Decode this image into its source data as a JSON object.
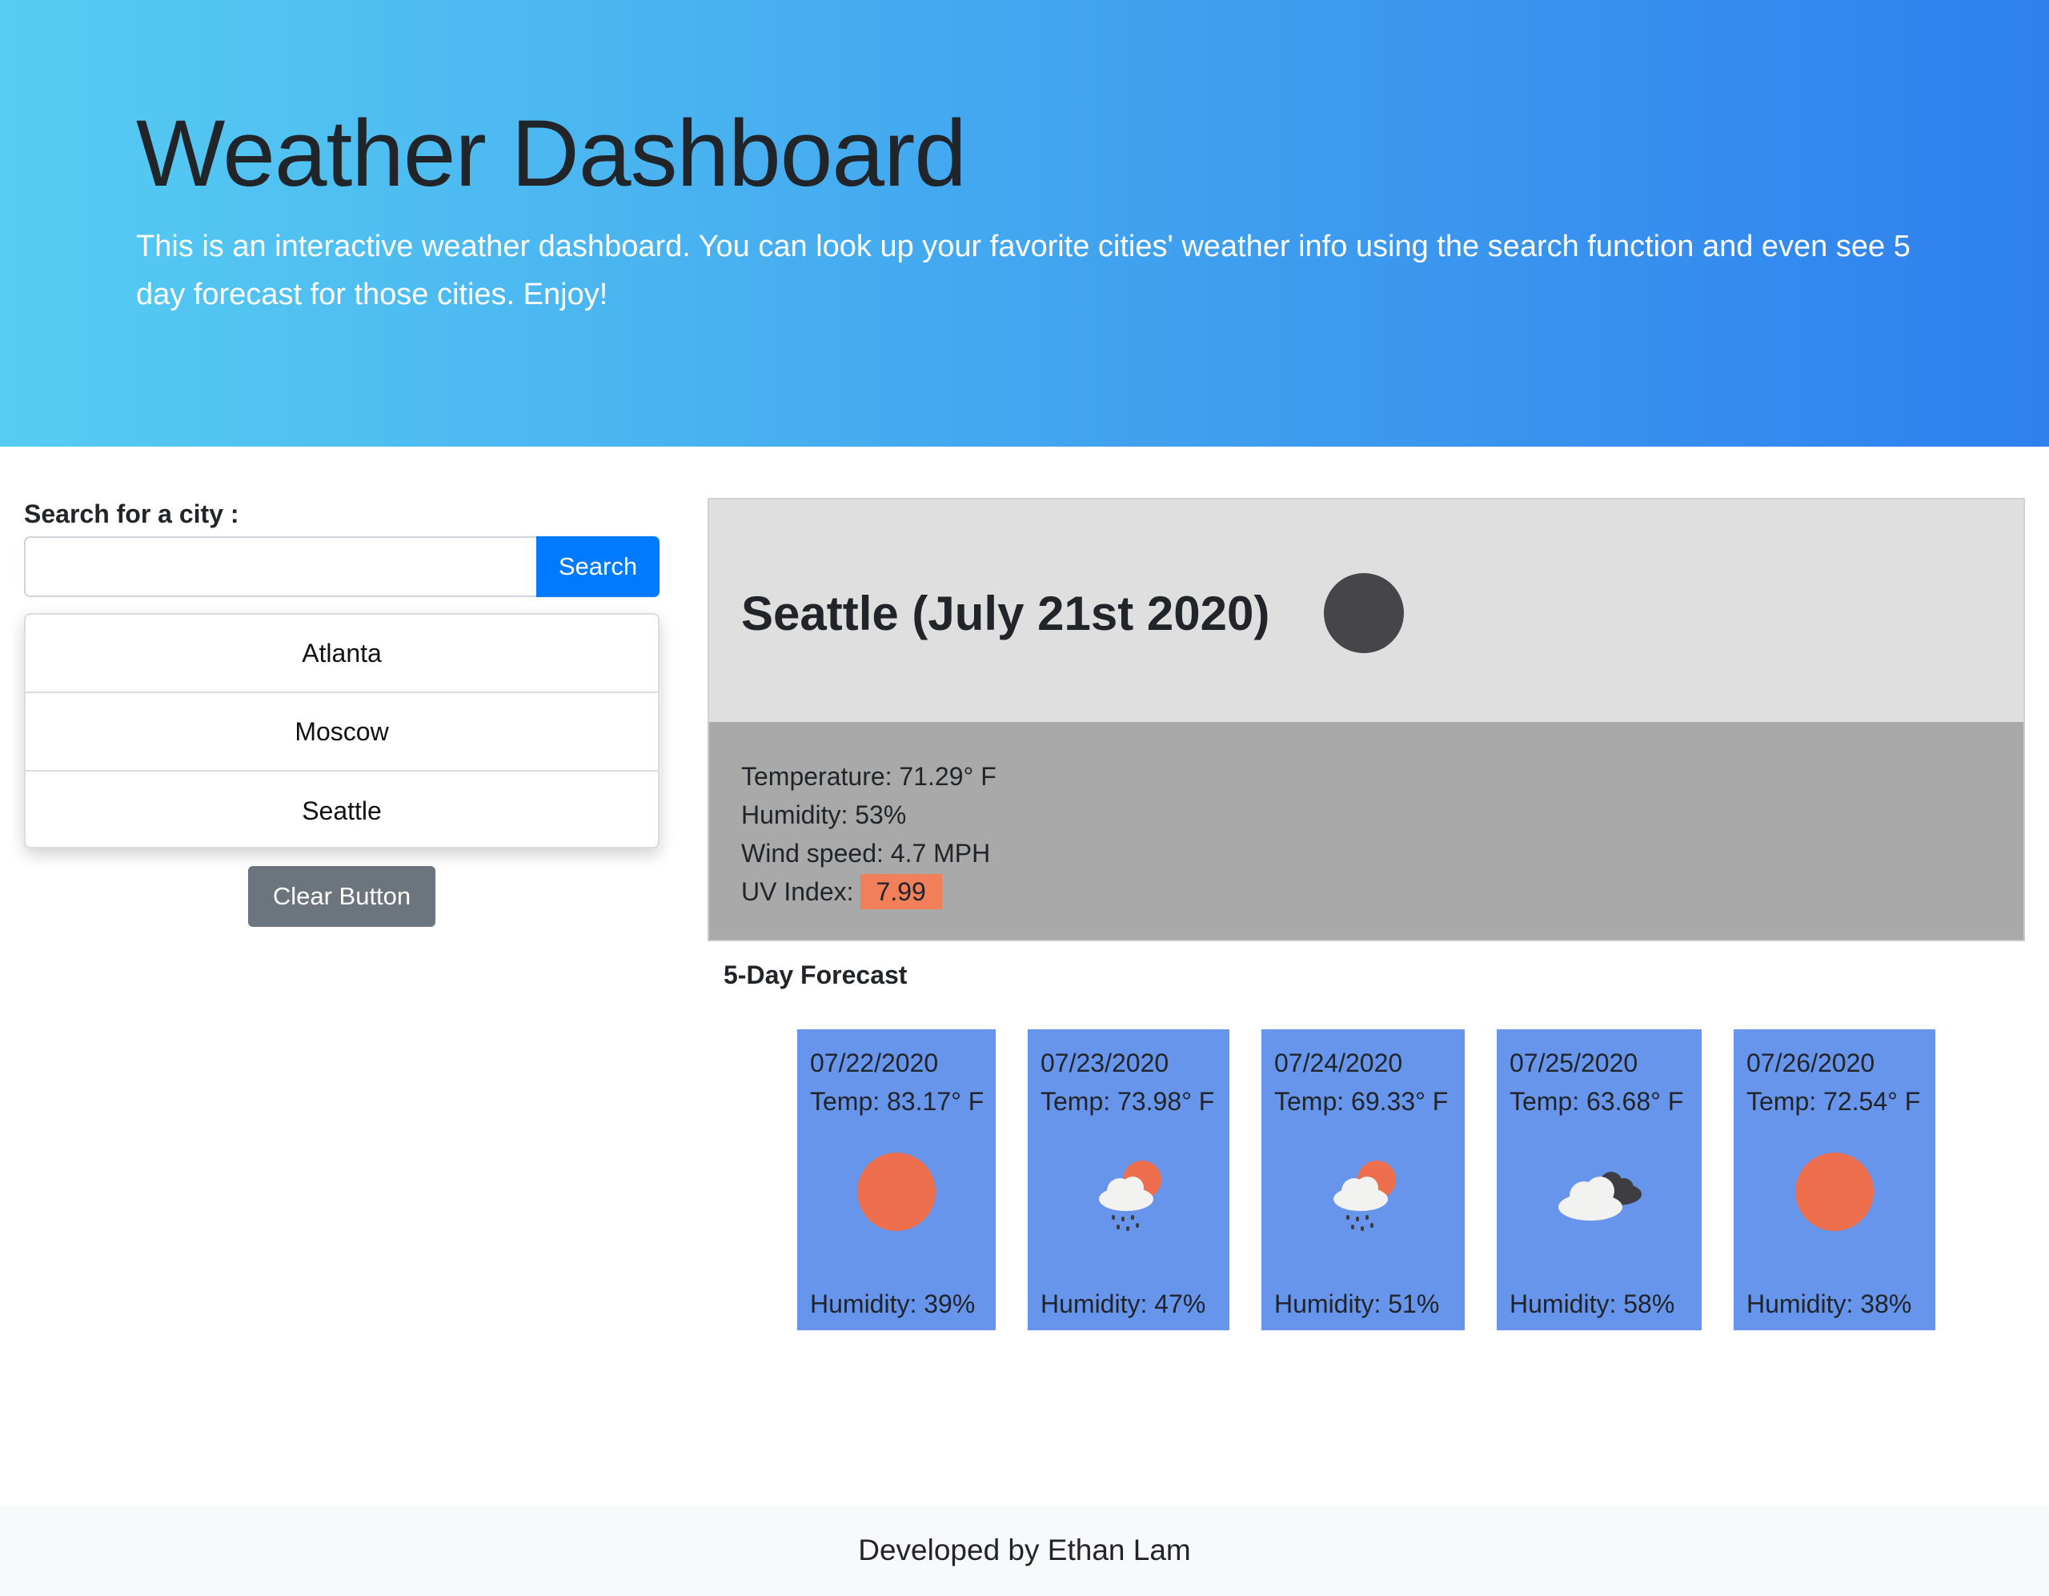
{
  "header": {
    "title": "Weather Dashboard",
    "description": "This is an interactive weather dashboard. You can look up your favorite cities' weather info using the search function and even see 5 day forecast for those cities. Enjoy!"
  },
  "search": {
    "label": "Search for a city :",
    "value": "",
    "button_label": "Search",
    "history": [
      "Atlanta",
      "Moscow",
      "Seattle"
    ],
    "clear_label": "Clear Button"
  },
  "current": {
    "title": "Seattle (July 21st 2020)",
    "icon": "moon-dark-icon",
    "temperature": "Temperature: 71.29° F",
    "humidity": "Humidity: 53%",
    "wind": "Wind speed: 4.7 MPH",
    "uv_label": "UV Index:",
    "uv_value": "7.99",
    "uv_color": "#f07f5a"
  },
  "forecast": {
    "title": "5-Day Forecast",
    "days": [
      {
        "date": "07/22/2020",
        "temp": "Temp: 83.17° F",
        "icon": "sun-icon",
        "humidity": "Humidity: 39%"
      },
      {
        "date": "07/23/2020",
        "temp": "Temp: 73.98° F",
        "icon": "sun-rain-cloud-icon",
        "humidity": "Humidity: 47%"
      },
      {
        "date": "07/24/2020",
        "temp": "Temp: 69.33° F",
        "icon": "sun-rain-cloud-icon",
        "humidity": "Humidity: 51%"
      },
      {
        "date": "07/25/2020",
        "temp": "Temp: 63.68° F",
        "icon": "broken-clouds-icon",
        "humidity": "Humidity: 58%"
      },
      {
        "date": "07/26/2020",
        "temp": "Temp: 72.54° F",
        "icon": "sun-icon",
        "humidity": "Humidity: 38%"
      }
    ]
  },
  "footer": {
    "text": "Developed by Ethan Lam"
  },
  "colors": {
    "hero_start": "#56ccf2",
    "hero_end": "#2f80ed",
    "primary_button": "#007bff",
    "secondary_button": "#6c757d",
    "forecast_card": "#6795ec",
    "sun": "#ec6e4c"
  }
}
